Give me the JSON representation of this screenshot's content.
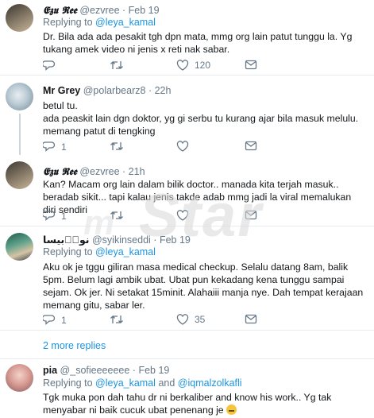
{
  "tweets": [
    {
      "name": "𝕰𝖟𝖚 𝕽𝖊𝖊",
      "handle": "@ezvree",
      "time": "Feb 19",
      "replying_prefix": "Replying to",
      "replying_to": "@leya_kamal",
      "text": "Dr. Bila ada ada pesakit tgh dpn mata, mmg org lain patut tunggu la. Yg tukang amek video ni jenis x reti nak sabar.",
      "likes": "120"
    },
    {
      "name": "Mr Grey",
      "handle": "@polarbearz8",
      "time": "22h",
      "text1": "betul tu.",
      "text2": "ada peaskit lain dgn doktor, yg gi serbu tu kurang ajar bila masuk melulu.",
      "text3": "memang patut di tengking",
      "replies": "1"
    },
    {
      "name": "𝕰𝖟𝖚 𝕽𝖊𝖊",
      "handle": "@ezvree",
      "time": "21h",
      "text": "Kan? Macam org lain dalam bilik doctor.. manada kita terjah masuk.. beradab sikit... tapi kalau jenis takde adab mmg jadi la viral memalukan diri sendiri",
      "replies": "1"
    },
    {
      "name": "نورٖبيسا",
      "handle": "@syikinseddi",
      "time": "Feb 19",
      "replying_prefix": "Replying to",
      "replying_to": "@leya_kamal",
      "text": "Aku ok je tggu giliran masa medical checkup. Selalu datang 8am, balik 5pm. Belum lagi ambik ubat. Ubat pun kekadang kena tunggu sampai sejam. Ok jer. Ni setakat 15minit. Alahaiii manja nye. Dah tempat kerajaan memang gitu, sabar ler.",
      "replies": "1",
      "likes": "35"
    },
    {
      "name": "pia",
      "handle": "@_sofieeeeeee",
      "time": "Feb 19",
      "replying_prefix": "Replying to",
      "replying_to": "@leya_kamal",
      "replying_and": "and",
      "replying_to2": "@iqmalzolkafli",
      "text": "Tgk muka pon dah tahu dr ni berkaliber and know his work.. Yg tak menyabar ni baik cucuk ubat penenang je"
    }
  ],
  "more_replies": "2 more replies",
  "watermark": {
    "letter": "m",
    "word": "Star"
  },
  "colors": {
    "link": "#1b95e0",
    "meta": "#657786",
    "divider": "#e6ecf0",
    "text": "#14171a"
  },
  "icons": [
    "reply-icon",
    "retweet-icon",
    "like-icon",
    "message-icon",
    "smile-emoji"
  ]
}
